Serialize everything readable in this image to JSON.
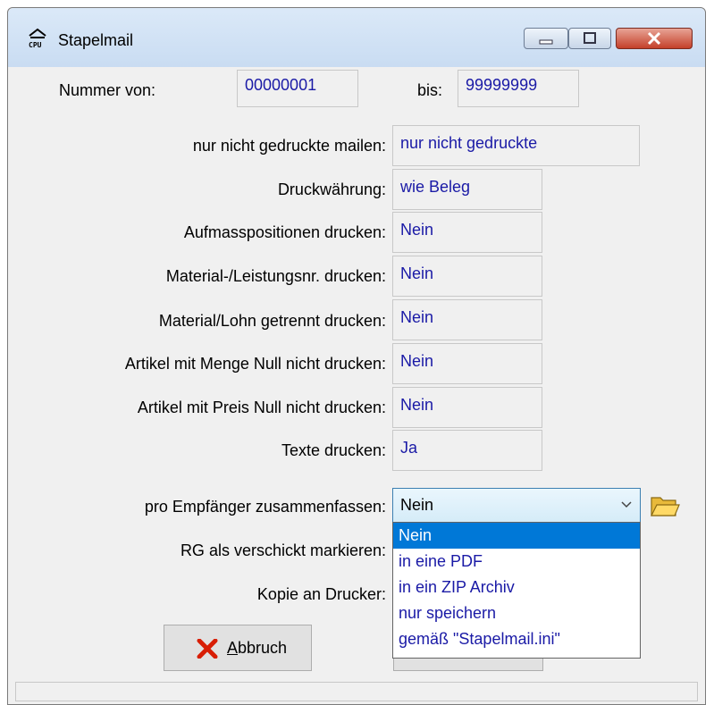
{
  "window": {
    "title": "Stapelmail",
    "icon": "cpu-app-icon"
  },
  "range": {
    "from_label": "Nummer von:",
    "from_value": "00000001",
    "to_label": "bis:",
    "to_value": "99999999"
  },
  "settings": [
    {
      "label": "nur nicht gedruckte mailen:",
      "value": "nur nicht gedruckte"
    },
    {
      "label": "Druckwährung:",
      "value": "wie Beleg"
    },
    {
      "label": "Aufmasspositionen drucken:",
      "value": "Nein"
    },
    {
      "label": "Material-/Leistungsnr. drucken:",
      "value": "Nein"
    },
    {
      "label": "Material/Lohn getrennt drucken:",
      "value": "Nein"
    },
    {
      "label": "Artikel mit Menge Null nicht drucken:",
      "value": "Nein"
    },
    {
      "label": "Artikel mit Preis Null nicht drucken:",
      "value": "Nein"
    },
    {
      "label": "Texte drucken:",
      "value": "Ja"
    }
  ],
  "combine": {
    "label": "pro Empfänger zusammenfassen:",
    "selected": "Nein",
    "options": [
      "Nein",
      "in eine PDF",
      "in ein ZIP Archiv",
      "nur speichern",
      "gemäß \"Stapelmail.ini\""
    ]
  },
  "mark_sent_label": "RG als verschickt markieren:",
  "copy_printer_label": "Kopie an Drucker:",
  "buttons": {
    "cancel_prefix": "A",
    "cancel_rest": "bbruch"
  },
  "colors": {
    "value_text": "#1a1aa6",
    "selection": "#0078d7"
  }
}
